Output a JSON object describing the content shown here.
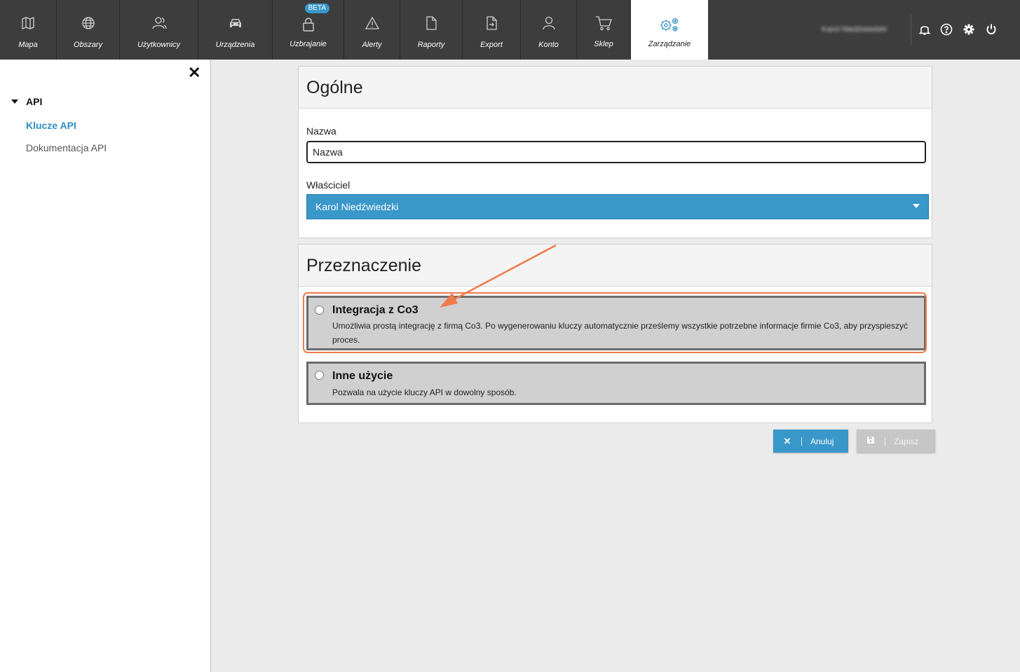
{
  "nav": {
    "items": [
      {
        "label": "Mapa",
        "icon": "map-icon"
      },
      {
        "label": "Obszary",
        "icon": "globe-icon"
      },
      {
        "label": "Użytkownicy",
        "icon": "users-icon"
      },
      {
        "label": "Urządzenia",
        "icon": "car-icon"
      },
      {
        "label": "Uzbrajanie",
        "icon": "lock-icon",
        "badge": "BETA"
      },
      {
        "label": "Alerty",
        "icon": "warning-icon"
      },
      {
        "label": "Raporty",
        "icon": "document-icon"
      },
      {
        "label": "Export",
        "icon": "export-icon"
      },
      {
        "label": "Konto",
        "icon": "user-icon"
      },
      {
        "label": "Sklep",
        "icon": "cart-icon"
      },
      {
        "label": "Zarządzanie",
        "icon": "gears-icon",
        "active": true
      }
    ],
    "user_name": "Karol Niedźwiedzki",
    "accent_color": "#3a97c9"
  },
  "sidebar": {
    "close_symbol": "✕",
    "group_label": "API",
    "links": [
      {
        "label": "Klucze API",
        "active": true
      },
      {
        "label": "Dokumentacja API",
        "active": false
      }
    ]
  },
  "general": {
    "title": "Ogólne",
    "name_label": "Nazwa",
    "name_value": "Nazwa",
    "owner_label": "Właściciel",
    "owner_value": "Karol Niedźwiedzki"
  },
  "purpose": {
    "title": "Przeznaczenie",
    "options": [
      {
        "title": "Integracja z Co3",
        "description": "Umożliwia prostą integrację z firmą Co3. Po wygenerowaniu kluczy automatycznie prześlemy wszystkie potrzebne informacje firmie Co3, aby przyspieszyć proces.",
        "highlighted": true
      },
      {
        "title": "Inne użycie",
        "description": "Pozwala na użycie kluczy API w dowolny sposób.",
        "highlighted": false
      }
    ]
  },
  "actions": {
    "cancel_label": "Anuluj",
    "save_label": "Zapisz"
  }
}
